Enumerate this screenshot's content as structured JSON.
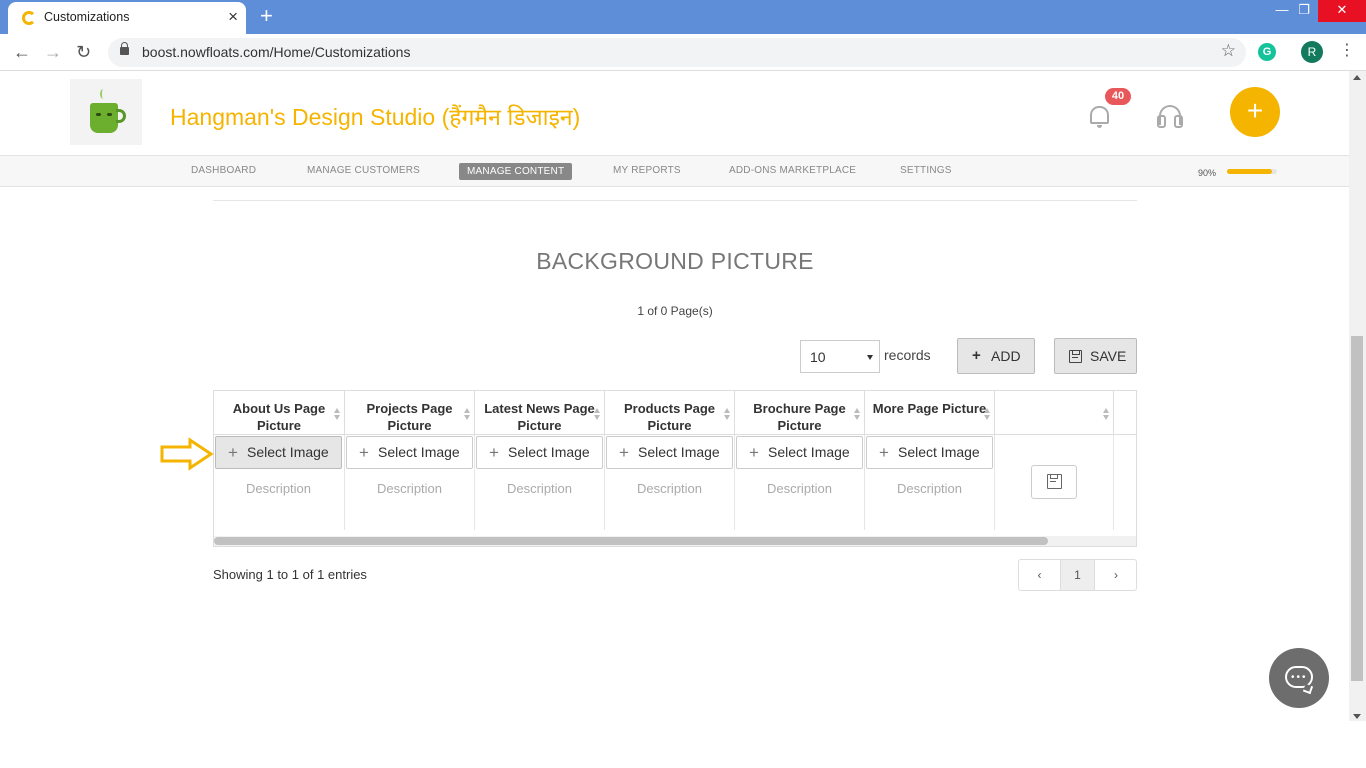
{
  "browser": {
    "tab_title": "Customizations",
    "new_tab_icon": "+",
    "url": "boost.nowfloats.com/Home/Customizations",
    "profile_initial": "R",
    "extension_letter": "G"
  },
  "header": {
    "business_name": "Hangman's Design Studio (हैंगमैन डिजाइन)",
    "notification_count": "40",
    "add_icon": "+"
  },
  "nav": {
    "items": [
      "DASHBOARD",
      "MANAGE CUSTOMERS",
      "MANAGE CONTENT",
      "MY REPORTS",
      "ADD-ONS MARKETPLACE",
      "SETTINGS"
    ],
    "active": "MANAGE CONTENT",
    "progress_label": "90%",
    "progress_value": 0.9
  },
  "content": {
    "section_title": "BACKGROUND PICTURE",
    "page_count": "1 of 0 Page(s)",
    "records_value": "10",
    "records_label": "records",
    "add_label": "ADD",
    "save_label": "SAVE"
  },
  "table": {
    "columns": [
      "About Us Page Picture",
      "Projects Page Picture",
      "Latest News Page Picture",
      "Products Page Picture",
      "Brochure Page Picture",
      "More Page Picture"
    ],
    "select_label": "Select Image",
    "description_placeholder": "Description"
  },
  "footer": {
    "showing": "Showing 1 to 1 of 1 entries",
    "prev": "‹",
    "page": "1",
    "next": "›"
  },
  "colors": {
    "brand": "#f5b400",
    "browser_chrome": "#5f8ed8",
    "badge": "#e8585b"
  }
}
